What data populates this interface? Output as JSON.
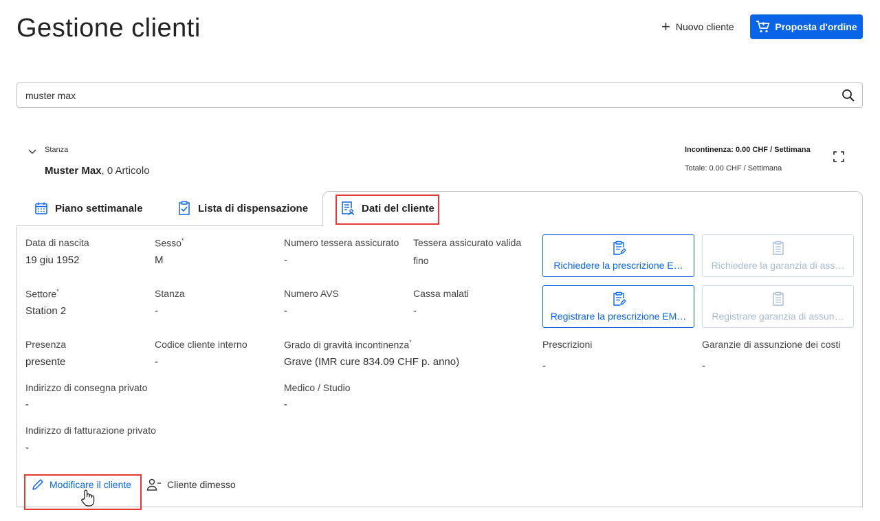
{
  "header": {
    "title": "Gestione clienti",
    "new_client_label": "Nuovo cliente",
    "order_proposal_label": "Proposta d'ordine"
  },
  "search": {
    "value": "muster max"
  },
  "client": {
    "room_label": "Stanza",
    "name": "Muster Max",
    "articles": ", 0 Articolo",
    "incontinence": "Incontinenza: 0.00 CHF / Settimana",
    "total": "Totale: 0.00 CHF / Settimana"
  },
  "tabs": [
    {
      "label": "Piano settimanale",
      "icon": "calendar-icon"
    },
    {
      "label": "Lista di dispensazione",
      "icon": "clipboard-check-icon"
    },
    {
      "label": "Dati del cliente",
      "icon": "client-data-icon",
      "active": true
    }
  ],
  "fields": {
    "birth": {
      "label": "Data di nascita",
      "value": "19 giu 1952"
    },
    "sex": {
      "label": "Sesso",
      "required": "*",
      "value": "M"
    },
    "insurance_card": {
      "label": "Numero tessera assicurato",
      "value": "-"
    },
    "insurance_valid": {
      "label": "Tessera assicurato valida",
      "value": "fino"
    },
    "sector": {
      "label": "Settore",
      "required": "*",
      "value": "Station 2"
    },
    "room": {
      "label": "Stanza",
      "value": "-"
    },
    "avs": {
      "label": "Numero AVS",
      "value": "-"
    },
    "health_insurance": {
      "label": "Cassa malati",
      "value": "-"
    },
    "presence": {
      "label": "Presenza",
      "value": "presente"
    },
    "internal_code": {
      "label": "Codice cliente interno",
      "value": "-"
    },
    "severity": {
      "label": "Grado di gravità incontinenza",
      "required": "*",
      "value": "Grave (IMR cure 834.09 CHF p. anno)"
    },
    "prescriptions": {
      "label": "Prescrizioni",
      "value": "-"
    },
    "cost_guarantees": {
      "label": "Garanzie di assunzione dei costi",
      "value": "-"
    },
    "private_delivery": {
      "label": "Indirizzo di consegna privato",
      "value": "-"
    },
    "doctor": {
      "label": "Medico / Studio",
      "value": "-"
    },
    "private_billing": {
      "label": "Indirizzo di fatturazione privato",
      "value": "-"
    }
  },
  "actions": {
    "request_prescription": "Richiedere la prescrizione E…",
    "request_guarantee": "Richiedere la garanzia di ass…",
    "register_prescription": "Registrare la prescrizione EM…",
    "register_guarantee": "Registrare garanzia di assun…"
  },
  "footer": {
    "edit_client": "Modificare il cliente",
    "discharge_client": "Cliente dimesso"
  },
  "colors": {
    "accent": "#0a64e8",
    "highlight": "#e53935",
    "disabled": "#a8bcd9"
  }
}
